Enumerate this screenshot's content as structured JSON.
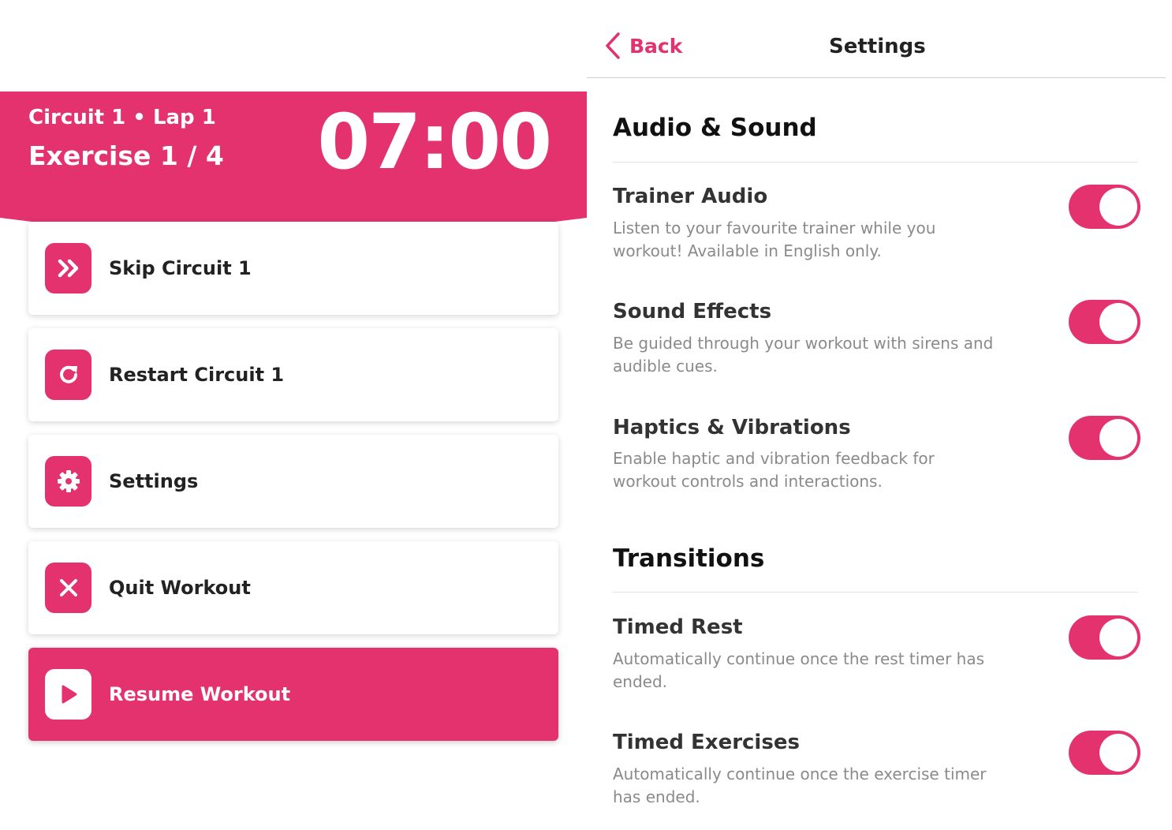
{
  "colors": {
    "accent": "#e3326e",
    "card_bg": "#ffffff",
    "muted_text": "#8a8a8a"
  },
  "workout": {
    "circuit_lap": "Circuit 1 • Lap 1",
    "exercise_count": "Exercise 1 / 4",
    "timer": "07:00"
  },
  "menu": [
    {
      "label": "Skip Circuit 1",
      "icon": "skip-forward-icon"
    },
    {
      "label": "Restart Circuit 1",
      "icon": "restart-icon"
    },
    {
      "label": "Settings",
      "icon": "gear-icon"
    },
    {
      "label": "Quit Workout",
      "icon": "close-icon"
    },
    {
      "label": "Resume Workout",
      "icon": "play-icon"
    }
  ],
  "settings": {
    "back_label": "Back",
    "title": "Settings",
    "sections": [
      {
        "title": "Audio & Sound",
        "rows": [
          {
            "title": "Trainer Audio",
            "description": "Listen to your favourite trainer while you workout! Available in English only.",
            "enabled": true
          },
          {
            "title": "Sound Effects",
            "description": "Be guided through your workout with sirens and audible cues.",
            "enabled": true
          },
          {
            "title": "Haptics & Vibrations",
            "description": "Enable haptic and vibration feedback for workout controls and interactions.",
            "enabled": true
          }
        ]
      },
      {
        "title": "Transitions",
        "rows": [
          {
            "title": "Timed Rest",
            "description": "Automatically continue once the rest timer has ended.",
            "enabled": true
          },
          {
            "title": "Timed Exercises",
            "description": "Automatically continue once the exercise timer has ended.",
            "enabled": true
          }
        ]
      }
    ]
  }
}
